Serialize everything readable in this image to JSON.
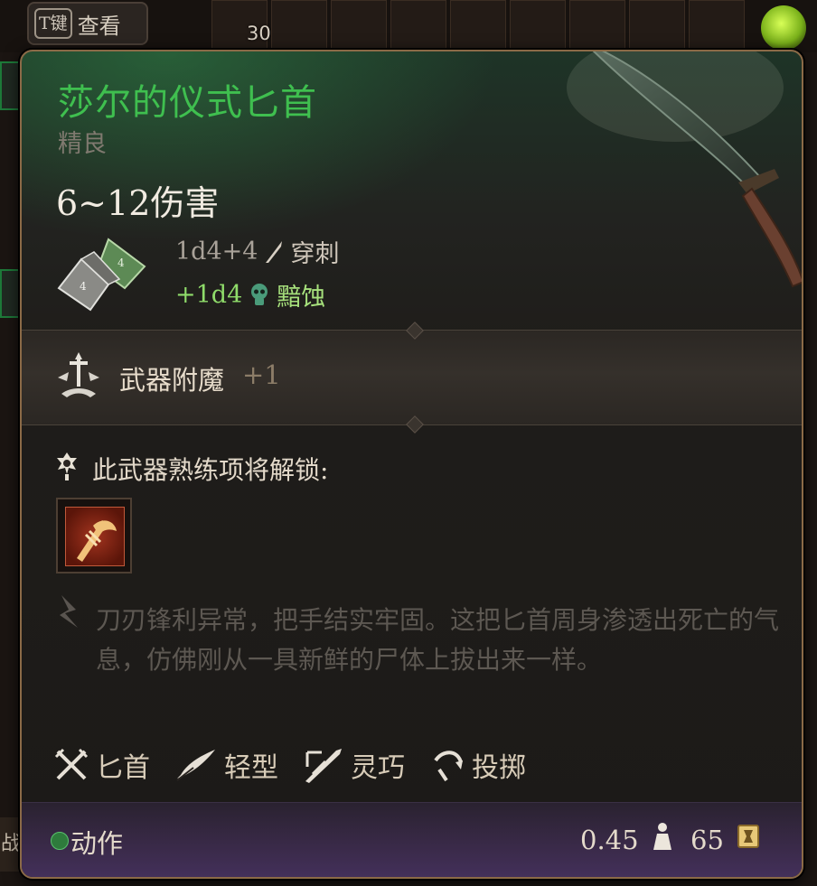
{
  "background": {
    "inspect_key": "T键",
    "inspect_label": "查看",
    "stack_count": "30",
    "left_edge_label": "战"
  },
  "tooltip": {
    "item_name": "莎尔的仪式匕首",
    "rarity": "精良",
    "damage_total": "6~12伤害",
    "damage_lines": [
      {
        "dice": "1d4+4",
        "type": "穿刺",
        "icon": "piercing-icon"
      },
      {
        "dice": "+1d4",
        "type": "黯蚀",
        "icon": "necrotic-skull-icon"
      }
    ],
    "enchantment": {
      "label": "武器附魔",
      "bonus": "+1"
    },
    "proficiency_text": "此武器熟练项将解锁:",
    "description": "刀刃锋利异常，把手结实牢固。这把匕首周身渗透出死亡的气息，仿佛刚从一具新鲜的尸体上拔出来一样。",
    "properties": [
      {
        "label": "匕首",
        "icon": "dagger-crossed-icon"
      },
      {
        "label": "轻型",
        "icon": "feather-icon"
      },
      {
        "label": "灵巧",
        "icon": "finesse-icon"
      },
      {
        "label": "投掷",
        "icon": "thrown-icon"
      }
    ],
    "footer": {
      "action_label": "动作",
      "weight": "0.45",
      "value": "65"
    },
    "colors": {
      "name": "#3fbf4f",
      "extra_damage": "#8fdc6a",
      "border": "#8b6a47"
    }
  }
}
